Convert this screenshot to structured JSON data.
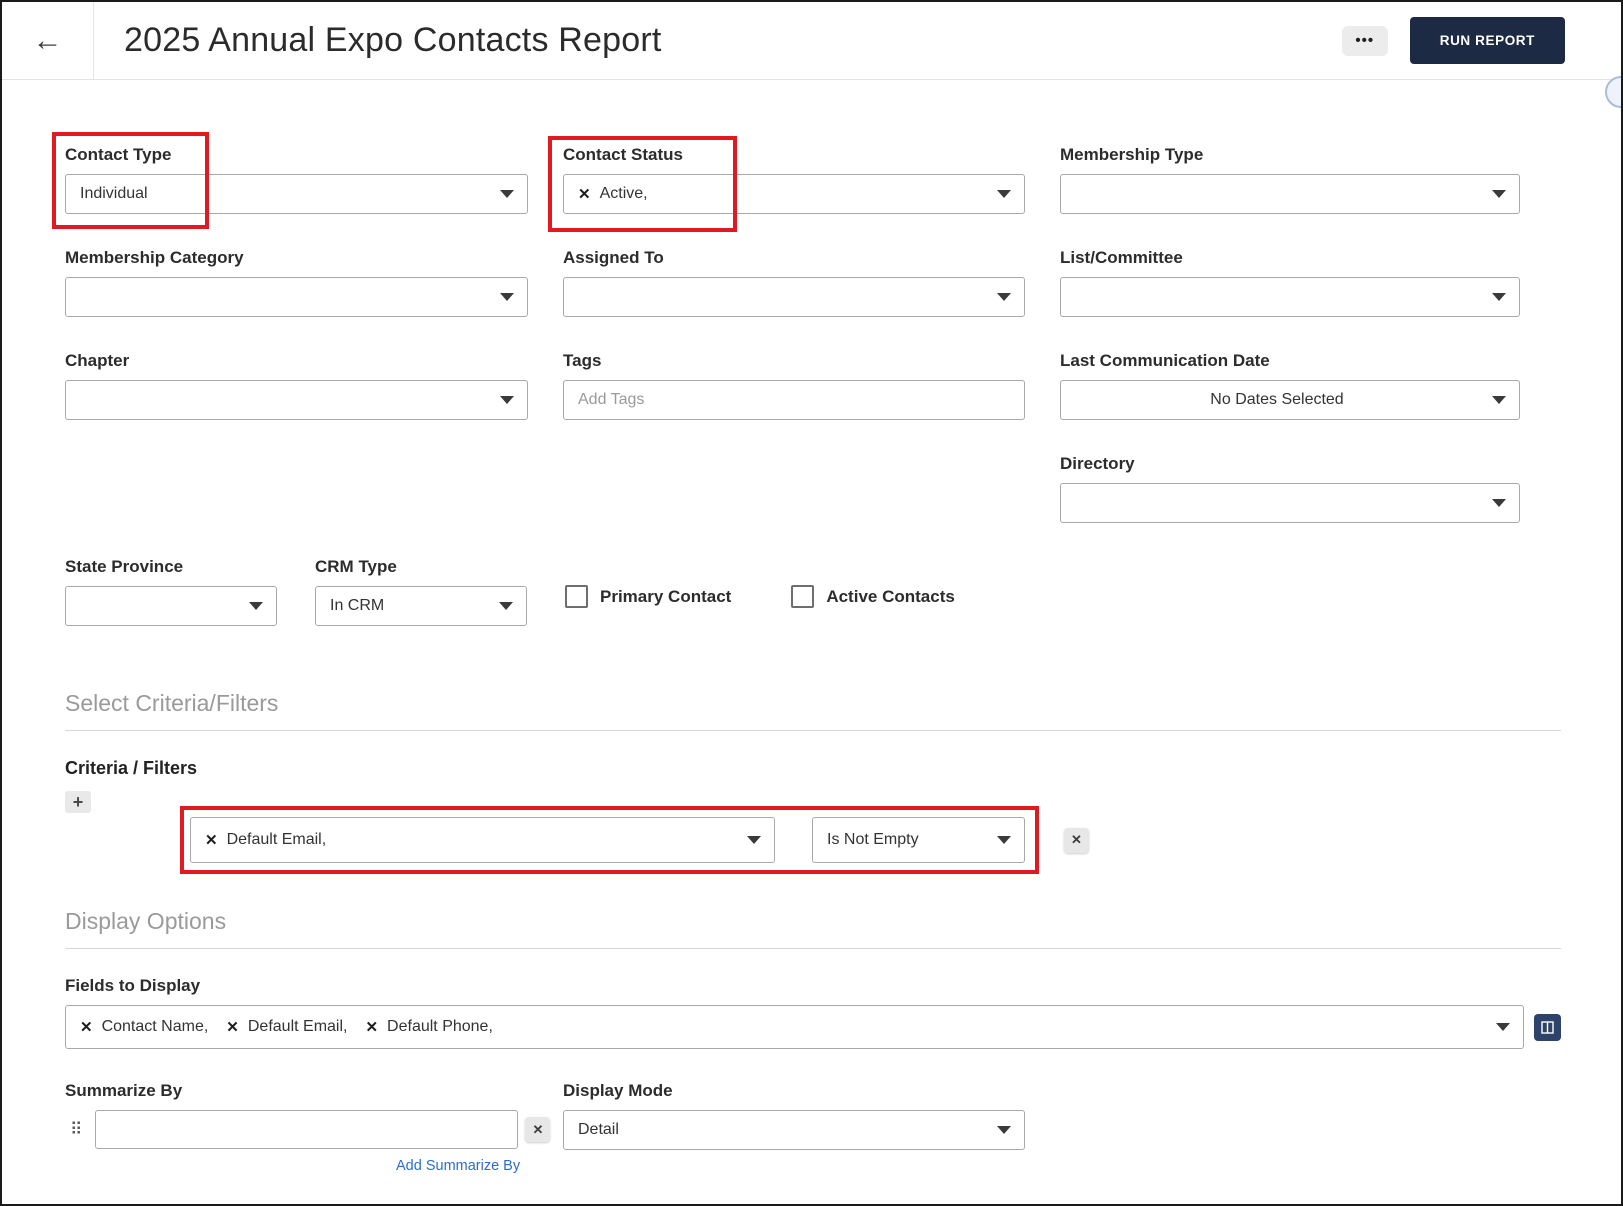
{
  "header": {
    "title": "2025 Annual Expo Contacts Report",
    "run_report_label": "RUN REPORT"
  },
  "icons": {
    "back_arrow": "←",
    "more": "•••",
    "remove_x": "✕",
    "plus": "+",
    "drag_handle": "⠿",
    "clear_x": "✕"
  },
  "colors": {
    "highlight_red": "#e11a22",
    "primary_button_navy": "#1d2a44",
    "link_blue": "#2b6cd4"
  },
  "filters": {
    "contact_type": {
      "label": "Contact Type",
      "value": "Individual"
    },
    "contact_status": {
      "label": "Contact Status",
      "value": "Active,"
    },
    "membership_type": {
      "label": "Membership Type",
      "value": ""
    },
    "membership_category": {
      "label": "Membership Category",
      "value": ""
    },
    "assigned_to": {
      "label": "Assigned To",
      "value": ""
    },
    "list_committee": {
      "label": "List/Committee",
      "value": ""
    },
    "chapter": {
      "label": "Chapter",
      "value": ""
    },
    "tags": {
      "label": "Tags",
      "placeholder": "Add Tags"
    },
    "last_communication_date": {
      "label": "Last Communication Date",
      "value": "No Dates Selected"
    },
    "directory": {
      "label": "Directory",
      "value": ""
    },
    "state_province": {
      "label": "State Province",
      "value": ""
    },
    "crm_type": {
      "label": "CRM Type",
      "value": "In CRM"
    },
    "primary_contact": {
      "label": "Primary Contact",
      "checked": false
    },
    "active_contacts": {
      "label": "Active Contacts",
      "checked": false
    }
  },
  "criteria_section": {
    "heading": "Select Criteria/Filters",
    "label": "Criteria / Filters",
    "filter_value": "Default Email,",
    "operator_value": "Is Not Empty"
  },
  "display_section": {
    "heading": "Display Options",
    "fields_label": "Fields to Display",
    "fields": [
      "Contact Name,",
      "Default Email,",
      "Default Phone,"
    ],
    "summarize_label": "Summarize By",
    "summarize_value": "",
    "add_summarize_link": "Add Summarize By",
    "display_mode_label": "Display Mode",
    "display_mode_value": "Detail"
  }
}
